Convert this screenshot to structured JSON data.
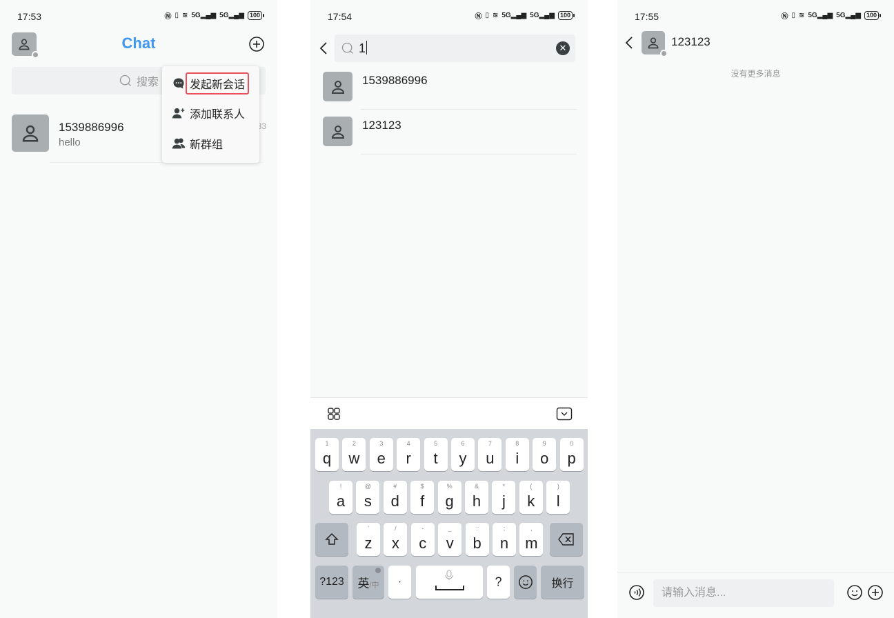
{
  "screens": [
    {
      "status": {
        "time": "17:53",
        "battery": "100"
      },
      "header": {
        "title": "Chat"
      },
      "search": {
        "placeholder": "搜索"
      },
      "conversations": [
        {
          "name": "1539886996",
          "last_message": "hello",
          "time": "33"
        }
      ],
      "popup_menu": {
        "items": [
          {
            "label": "发起新会话",
            "icon": "chat-bubble-icon",
            "highlighted": true
          },
          {
            "label": "添加联系人",
            "icon": "add-user-icon"
          },
          {
            "label": "新群组",
            "icon": "group-icon"
          }
        ]
      }
    },
    {
      "status": {
        "time": "17:54",
        "battery": "100"
      },
      "search": {
        "value": "1"
      },
      "results": [
        {
          "name": "1539886996"
        },
        {
          "name": "123123"
        }
      ],
      "keyboard": {
        "row1": [
          [
            "q",
            "1"
          ],
          [
            "w",
            "2"
          ],
          [
            "e",
            "3"
          ],
          [
            "r",
            "4"
          ],
          [
            "t",
            "5"
          ],
          [
            "y",
            "6"
          ],
          [
            "u",
            "7"
          ],
          [
            "i",
            "8"
          ],
          [
            "o",
            "9"
          ],
          [
            "p",
            "0"
          ]
        ],
        "row2": [
          [
            "a",
            "!"
          ],
          [
            "s",
            "@"
          ],
          [
            "d",
            "#"
          ],
          [
            "f",
            "$"
          ],
          [
            "g",
            "%"
          ],
          [
            "h",
            "&"
          ],
          [
            "j",
            "*"
          ],
          [
            "k",
            "("
          ],
          [
            "l",
            ")"
          ]
        ],
        "row3": [
          [
            "z",
            "'"
          ],
          [
            "x",
            "/"
          ],
          [
            "c",
            "-"
          ],
          [
            "v",
            "_"
          ],
          [
            "b",
            ":"
          ],
          [
            "n",
            ";"
          ],
          [
            "m",
            ","
          ]
        ],
        "bottom": {
          "numbers": "?123",
          "lang": "英",
          "lang_alt": "/中",
          "dot": "·",
          "question": "?",
          "enter": "换行"
        }
      }
    },
    {
      "status": {
        "time": "17:55",
        "battery": "100"
      },
      "chat": {
        "title": "123123",
        "no_more": "没有更多消息"
      },
      "input": {
        "placeholder": "请输入消息..."
      }
    }
  ]
}
